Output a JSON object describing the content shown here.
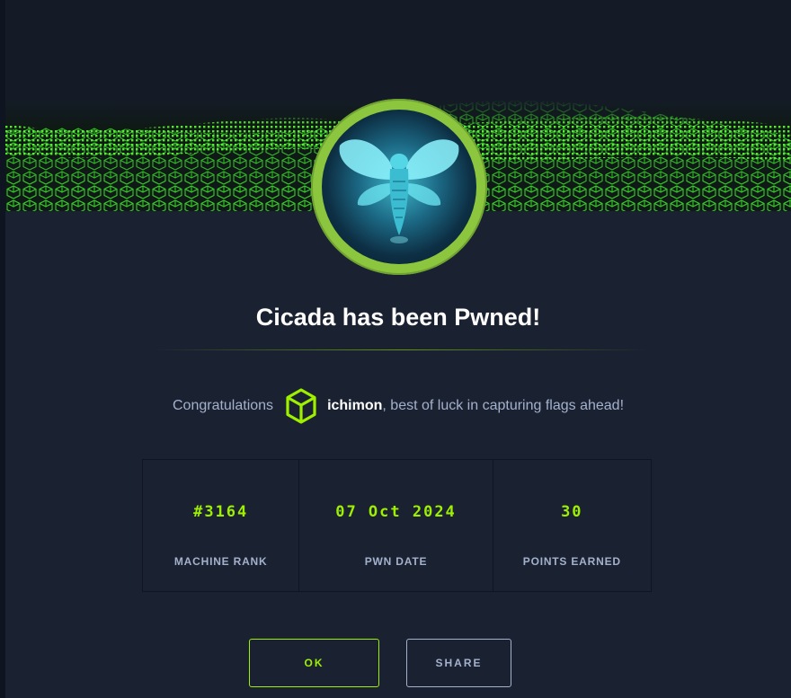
{
  "dialog": {
    "title": "Cicada has been Pwned!",
    "congrats_prefix": "Congratulations",
    "username": "ichimon",
    "congrats_suffix": ", best of luck in capturing flags ahead!",
    "badge_icon": "cicada-icon",
    "user_icon": "cube-icon"
  },
  "stats": [
    {
      "value": "#3164",
      "label": "MACHINE RANK"
    },
    {
      "value": "07 Oct 2024",
      "label": "PWN DATE"
    },
    {
      "value": "30",
      "label": "POINTS EARNED"
    }
  ],
  "buttons": {
    "ok": "OK",
    "share": "SHARE"
  },
  "colors": {
    "accent": "#9fef00",
    "badge_ring": "#8cc63f",
    "background": "#1a2231",
    "muted_text": "#a4b1cd"
  }
}
